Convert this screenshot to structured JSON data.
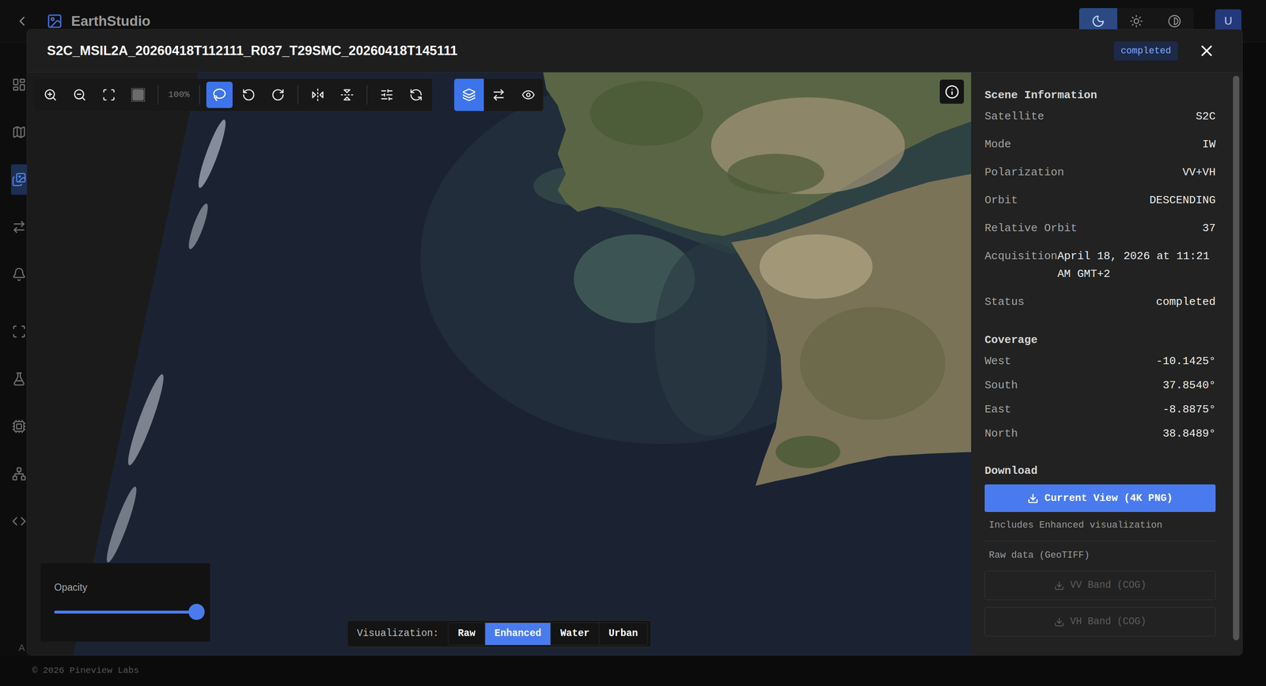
{
  "app": {
    "name": "EarthStudio",
    "avatar": "U",
    "theme_buttons": [
      {
        "selected": true
      },
      {
        "selected": false
      },
      {
        "selected": false
      }
    ]
  },
  "sidebar": {
    "items": [
      {
        "selected": false
      },
      {
        "selected": false
      },
      {
        "selected": true
      },
      {
        "selected": false
      },
      {
        "selected": false
      },
      {
        "selected": false
      },
      {
        "selected": false
      },
      {
        "selected": false
      },
      {
        "selected": false
      },
      {
        "selected": false
      }
    ],
    "footer_letter": "A"
  },
  "footer": {
    "copyright": "© 2026 Pineview Labs"
  },
  "modal": {
    "title": "S2C_MSIL2A_20260418T112111_R037_T29SMC_20260418T145111",
    "status_badge": "completed"
  },
  "toolbar": {
    "zoom_level": "100%",
    "tools": [
      {
        "selected": false,
        "disabled": false
      },
      {
        "selected": false,
        "disabled": false
      },
      {
        "selected": false,
        "disabled": false
      },
      {
        "selected": false,
        "disabled": true
      },
      {
        "selected": true,
        "disabled": false
      },
      {
        "selected": false,
        "disabled": false
      },
      {
        "selected": false,
        "disabled": false
      },
      {
        "selected": false,
        "disabled": false
      },
      {
        "selected": false,
        "disabled": false
      },
      {
        "selected": false,
        "disabled": false
      },
      {
        "selected": false,
        "disabled": false
      }
    ]
  },
  "view_modes": [
    {
      "selected": true
    },
    {
      "selected": false
    },
    {
      "selected": false
    }
  ],
  "opacity": {
    "label": "Opacity",
    "level": 1
  },
  "visualization": {
    "label": "Visualization:",
    "options": [
      {
        "label": "Raw",
        "selected": false
      },
      {
        "label": "Enhanced",
        "selected": true
      },
      {
        "label": "Water",
        "selected": false
      },
      {
        "label": "Urban",
        "selected": false
      }
    ]
  },
  "scene_info": {
    "heading": "Scene Information",
    "rows": [
      {
        "label": "Satellite",
        "value": "S2C"
      },
      {
        "label": "Mode",
        "value": "IW"
      },
      {
        "label": "Polarization",
        "value": "VV+VH"
      },
      {
        "label": "Orbit",
        "value": "DESCENDING"
      },
      {
        "label": "Relative Orbit",
        "value": "37"
      },
      {
        "label": "Acquisition",
        "value": "April 18, 2026 at 11:21 AM GMT+2"
      },
      {
        "label": "Status",
        "value": "completed"
      }
    ]
  },
  "coverage": {
    "heading": "Coverage",
    "rows": [
      {
        "label": "West",
        "value": "-10.1425°"
      },
      {
        "label": "South",
        "value": "37.8540°"
      },
      {
        "label": "East",
        "value": "-8.8875°"
      },
      {
        "label": "North",
        "value": "38.8489°"
      }
    ]
  },
  "download": {
    "heading": "Download",
    "primary": "Current View (4K PNG)",
    "note": "Includes Enhanced visualization",
    "raw_heading": "Raw data (GeoTIFF)",
    "bands": [
      {
        "label": "VV Band (COG)",
        "disabled": true
      },
      {
        "label": "VH Band (COG)",
        "disabled": true
      }
    ]
  }
}
